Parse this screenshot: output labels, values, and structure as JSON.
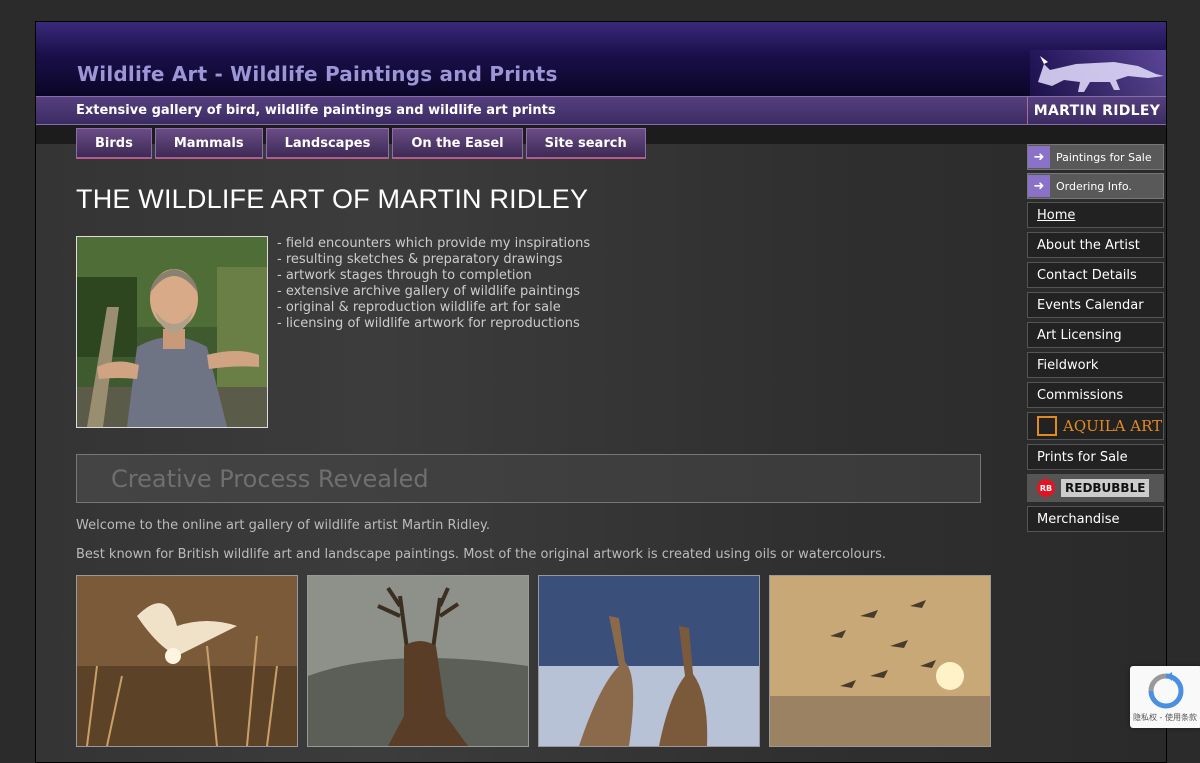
{
  "header": {
    "site_title": "Wildlife Art - Wildlife Paintings and Prints",
    "tagline": "Extensive gallery of bird, wildlife paintings and wildlife art prints",
    "artist_name": "MARTIN RIDLEY"
  },
  "nav": {
    "tabs": [
      {
        "label": "Birds"
      },
      {
        "label": "Mammals"
      },
      {
        "label": "Landscapes"
      },
      {
        "label": "On the Easel"
      },
      {
        "label": "Site search"
      }
    ]
  },
  "main": {
    "title": "THE WILDLIFE ART OF MARTIN RIDLEY",
    "intro_items": [
      "- field encounters which provide my inspirations",
      "- resulting sketches & preparatory drawings",
      "- artwork stages through to completion",
      "- extensive archive gallery of wildlife paintings",
      "- original & reproduction wildlife art for sale",
      "- licensing of wildlife artwork for reproductions"
    ],
    "creative_heading": "Creative Process Revealed",
    "welcome": "Welcome to the online art gallery of wildlife artist Martin Ridley.",
    "best_known": "Best known for British wildlife art and landscape paintings. Most of the original artwork is created using oils or watercolours."
  },
  "sidebar": {
    "sale_links": [
      {
        "label": "Paintings for Sale"
      },
      {
        "label": "Ordering Info."
      }
    ],
    "items": [
      {
        "label": "Home"
      },
      {
        "label": "About the Artist"
      },
      {
        "label": "Contact Details"
      },
      {
        "label": "Events Calendar"
      },
      {
        "label": "Art Licensing"
      },
      {
        "label": "Fieldwork"
      },
      {
        "label": "Commissions"
      }
    ],
    "aquila_logo": "AQUILA ART",
    "prints_label": "Prints for Sale",
    "redbubble_logo": "REDBUBBLE",
    "merch_label": "Merchandise"
  },
  "recaptcha": {
    "footer": "隐私权 - 使用条款"
  },
  "colors": {
    "accent_purple": "#8b72c9",
    "tab_border": "#b85b8c",
    "aquila_orange": "#e38a1f",
    "redbubble_red": "#e41321"
  }
}
